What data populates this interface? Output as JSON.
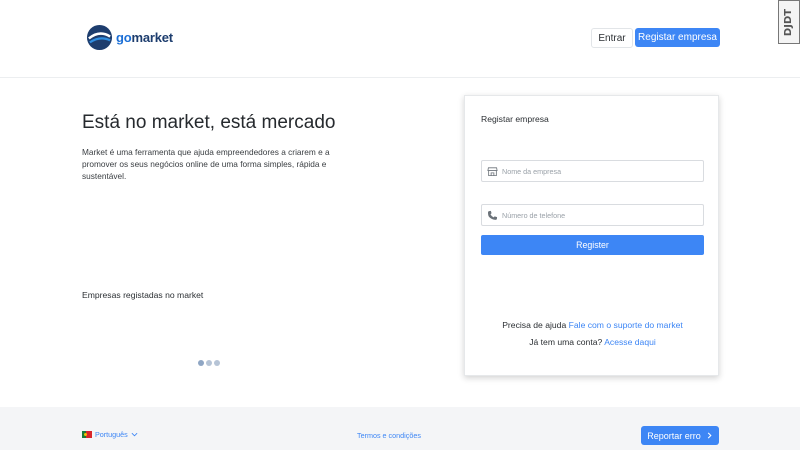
{
  "header": {
    "logo_text_prefix": "go",
    "logo_text_suffix": "market",
    "login_label": "Entrar",
    "register_label": "Registar empresa"
  },
  "side_tag": {
    "text": "DJDT"
  },
  "hero": {
    "title": "Está no market, está mercado",
    "description": "Market é uma ferramenta que ajuda empreendedores a criarem e a promover os seus negócios online de uma forma simples, rápida e sustentável.",
    "companies_title": "Empresas registadas no market",
    "carousel": {
      "dot_count": 3,
      "active_index": 0
    }
  },
  "form": {
    "title": "Registar empresa",
    "company_name": {
      "placeholder": "Nome da empresa",
      "value": "",
      "icon": "store-icon"
    },
    "phone": {
      "placeholder": "Número de telefone",
      "value": "",
      "icon": "phone-icon"
    },
    "submit_label": "Register",
    "help_text": "Precisa de ajuda",
    "help_link": "Fale com o suporte do market",
    "account_text": "Já tem uma conta?",
    "account_link": "Acesse daqui"
  },
  "footer": {
    "language": "Português",
    "terms_label": "Termos e condições",
    "report_label": "Reportar erro"
  },
  "colors": {
    "accent": "#3d86f5",
    "logo_dark": "#1d3d6e",
    "footer_bg": "#f4f5f7"
  }
}
